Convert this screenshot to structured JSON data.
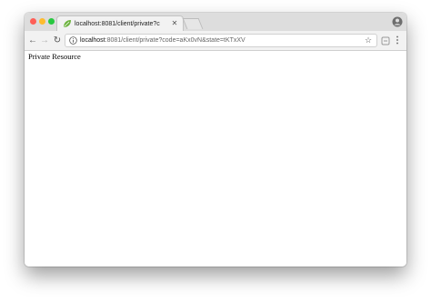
{
  "tab": {
    "title": "localhost:8081/client/private?c",
    "close_glyph": "✕",
    "favicon": "leaf-icon"
  },
  "toolbar": {
    "back_glyph": "←",
    "forward_glyph": "→",
    "reload_glyph": "↻",
    "url_host": "localhost",
    "url_rest": ":8081/client/private?code=aKx0vN&state=tKTxXV",
    "star_glyph": "☆",
    "menu_glyph": "⋮"
  },
  "page": {
    "text": "Private Resource"
  },
  "colors": {
    "close": "#ff5f57",
    "minimize": "#febc2e",
    "maximize": "#28c840"
  }
}
